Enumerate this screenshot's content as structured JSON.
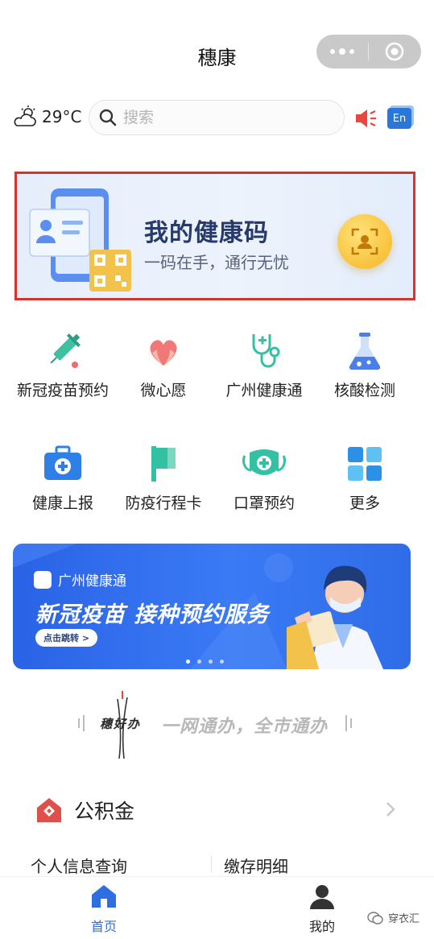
{
  "header": {
    "title": "穗康"
  },
  "weather": {
    "temperature": "29°C",
    "icon": "partly-cloudy-icon"
  },
  "search": {
    "placeholder": "搜索"
  },
  "lang_button": {
    "label": "En"
  },
  "health_code": {
    "title": "我的健康码",
    "subtitle": "一码在手，通行无忧",
    "highlight_color": "#d7332d"
  },
  "services": [
    {
      "label": "新冠疫苗预约",
      "icon": "vaccine-syringe-icon"
    },
    {
      "label": "微心愿",
      "icon": "heart-hands-icon"
    },
    {
      "label": "广州健康通",
      "icon": "stethoscope-icon"
    },
    {
      "label": "核酸检测",
      "icon": "flask-icon"
    },
    {
      "label": "健康上报",
      "icon": "medical-kit-icon"
    },
    {
      "label": "防疫行程卡",
      "icon": "flag-icon"
    },
    {
      "label": "口罩预约",
      "icon": "face-mask-icon"
    },
    {
      "label": "更多",
      "icon": "grid-more-icon"
    }
  ],
  "promo": {
    "source": "广州健康通",
    "headline": "新冠疫苗 接种预约服务",
    "cta": "点击跳转 >",
    "pages": 4,
    "active_page": 1
  },
  "slogan": {
    "brand": "穗好办",
    "tagline": "一网通办，全市通办"
  },
  "provident_fund": {
    "title": "公积金",
    "items": [
      "个人信息查询",
      "缴存明细"
    ]
  },
  "tabbar": {
    "items": [
      {
        "label": "首页",
        "active": true,
        "icon": "home-icon"
      },
      {
        "label": "我的",
        "active": false,
        "icon": "user-icon"
      }
    ]
  },
  "watermark": {
    "text": "穿衣汇"
  },
  "colors": {
    "accent": "#2a76d9",
    "active_tab": "#2f6ee0",
    "banner_blue": "#3a7af5"
  }
}
